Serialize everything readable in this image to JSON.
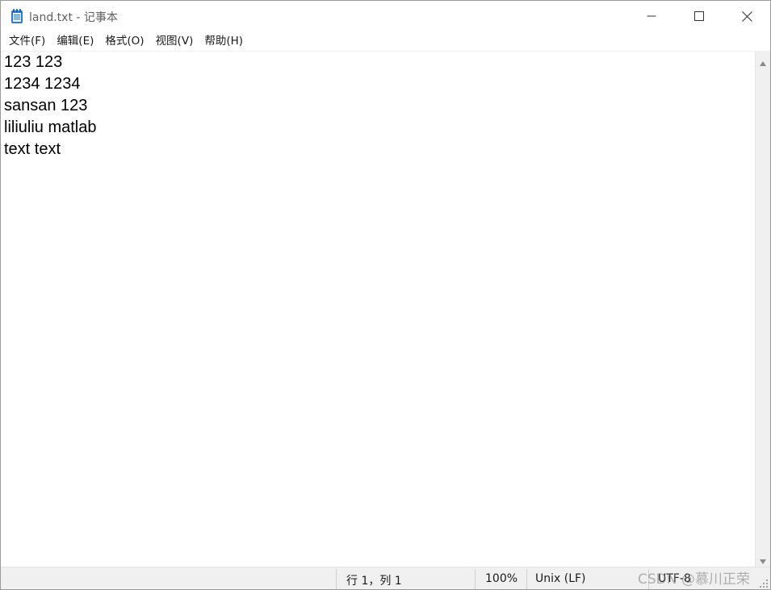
{
  "window": {
    "title": "land.txt - 记事本"
  },
  "menu": {
    "items": [
      "文件(F)",
      "编辑(E)",
      "格式(O)",
      "视图(V)",
      "帮助(H)"
    ]
  },
  "editor": {
    "lines": [
      "123 123",
      "1234 1234",
      "sansan 123",
      "liliuliu matlab",
      "text text"
    ]
  },
  "status": {
    "position": "行 1，列 1",
    "zoom": "100%",
    "line_ending": "Unix (LF)",
    "encoding": "UTF-8"
  },
  "watermark": "CSDN @慕川正荣",
  "icons": {
    "app": "notepad-icon",
    "minimize": "minimize-icon",
    "maximize": "maximize-icon",
    "close": "close-icon",
    "scroll_up": "scroll-up-arrow-icon",
    "scroll_down": "scroll-down-arrow-icon",
    "grip": "resize-grip-icon"
  },
  "colors": {
    "app_icon": "#1e88e5",
    "status_bg": "#f0f0f0"
  }
}
